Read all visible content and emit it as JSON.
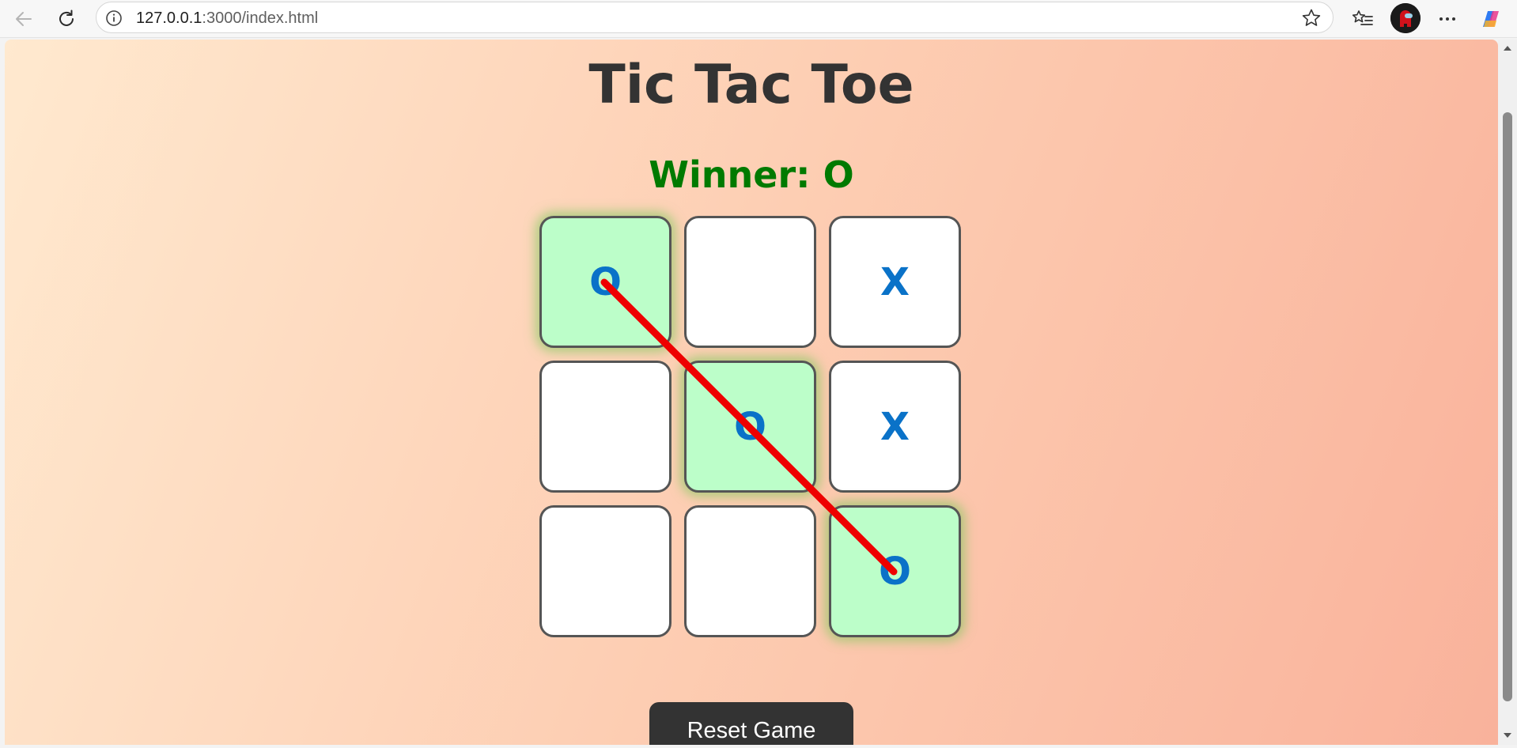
{
  "browser": {
    "url_host": "127.0.0.1",
    "url_rest": ":3000/index.html",
    "icons": {
      "back": "back-arrow-icon",
      "reload": "reload-icon",
      "info": "site-info-icon",
      "favorite": "star-icon",
      "favorites": "favorites-list-icon",
      "profile": "profile-avatar",
      "menu": "more-icon",
      "copilot": "copilot-icon"
    }
  },
  "game": {
    "title": "Tic Tac Toe",
    "status": "Winner: O",
    "status_color": "#007a00",
    "board": [
      "O",
      "",
      "X",
      "",
      "O",
      "X",
      "",
      "",
      "O"
    ],
    "winning_cells": [
      0,
      4,
      8
    ],
    "mark_color": "#0a72c8",
    "win_cell_color": "#bcfec9",
    "win_line_color": "#ee0000",
    "reset_label": "Reset Game"
  }
}
